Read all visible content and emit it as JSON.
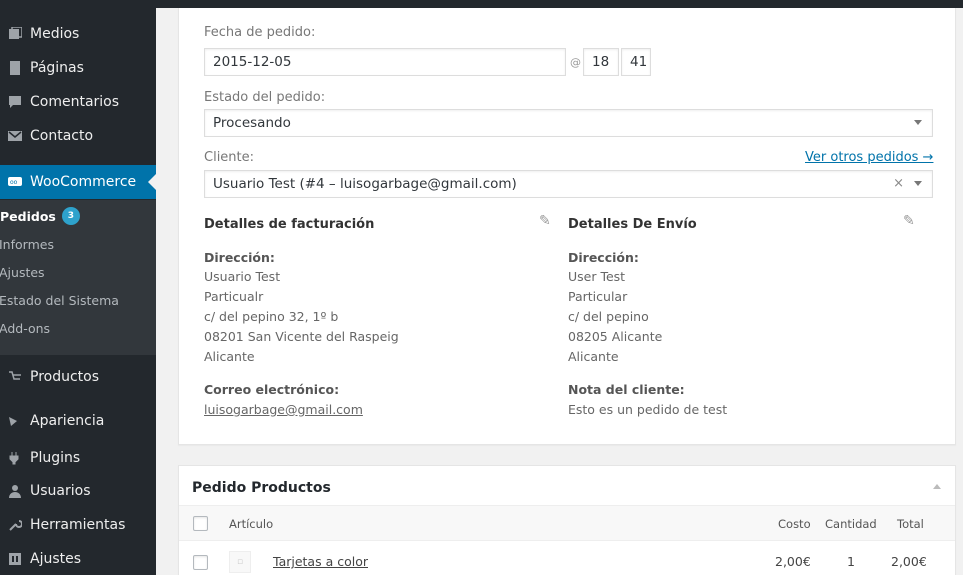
{
  "sidebar": {
    "items": [
      {
        "label": "Medios",
        "icon": "media-icon"
      },
      {
        "label": "Páginas",
        "icon": "page-icon"
      },
      {
        "label": "Comentarios",
        "icon": "comment-icon"
      },
      {
        "label": "Contacto",
        "icon": "mail-icon"
      },
      {
        "label": "WooCommerce",
        "icon": "woo-icon"
      },
      {
        "label": "Productos",
        "icon": "cart-icon"
      },
      {
        "label": "Apariencia",
        "icon": "brush-icon"
      },
      {
        "label": "Plugins",
        "icon": "plug-icon"
      },
      {
        "label": "Usuarios",
        "icon": "user-icon"
      },
      {
        "label": "Herramientas",
        "icon": "wrench-icon"
      },
      {
        "label": "Ajustes",
        "icon": "settings-icon"
      }
    ],
    "woo_submenu": [
      {
        "label": "Pedidos",
        "badge": "3"
      },
      {
        "label": "Informes"
      },
      {
        "label": "Ajustes"
      },
      {
        "label": "Estado del Sistema"
      },
      {
        "label": "Add-ons"
      }
    ]
  },
  "order": {
    "date_label": "Fecha de pedido:",
    "date_value": "2015-12-05",
    "at": "@",
    "hour": "18",
    "minute": "41",
    "status_label": "Estado del pedido:",
    "status_value": "Procesando",
    "customer_label": "Cliente:",
    "other_orders_link": "Ver otros pedidos →",
    "customer_value": "Usuario Test (#4 – luisogarbage@gmail.com)"
  },
  "billing": {
    "title": "Detalles de facturación",
    "address_label": "Dirección:",
    "address_lines": [
      "Usuario Test",
      "Particualr",
      "c/ del pepino 32, 1º b",
      "08201 San Vicente del Raspeig",
      "Alicante"
    ],
    "email_label": "Correo electrónico:",
    "email": "luisogarbage@gmail.com"
  },
  "shipping": {
    "title": "Detalles De Envío",
    "address_label": "Dirección:",
    "address_lines": [
      "User Test",
      "Particular",
      "c/ del pepino",
      "08205 Alicante",
      "Alicante"
    ],
    "note_label": "Nota del cliente:",
    "note": "Esto es un pedido de test"
  },
  "products": {
    "title": "Pedido Productos",
    "columns": {
      "item": "Artículo",
      "cost": "Costo",
      "qty": "Cantidad",
      "total": "Total"
    },
    "rows": [
      {
        "name": "Tarjetas a color",
        "cost": "2,00€",
        "qty": "1",
        "total": "2,00€"
      }
    ]
  },
  "colors": {
    "accent": "#0073aa",
    "sidebar_bg": "#23282d",
    "badge": "#2ea2cc"
  }
}
